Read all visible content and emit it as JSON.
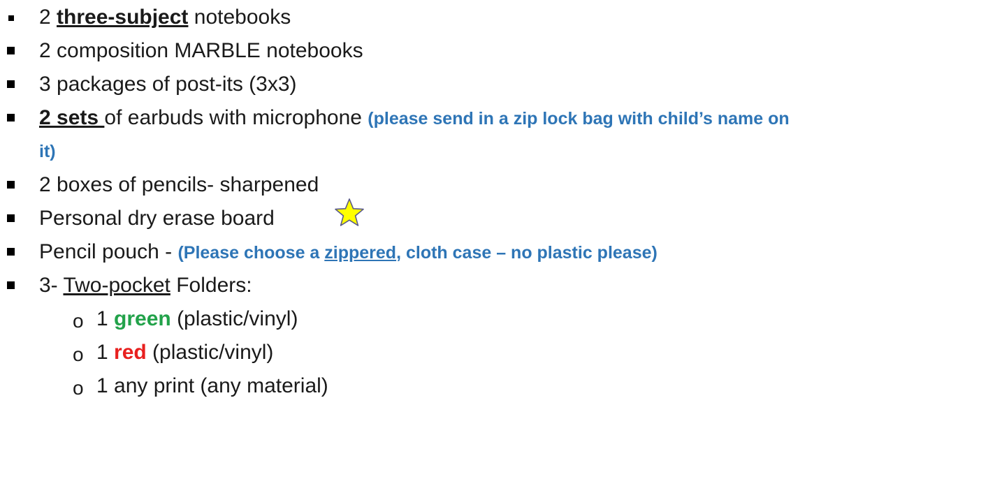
{
  "items": [
    {
      "prefix": "2 ",
      "emphasis": "three-subject",
      "suffix": " notebooks"
    },
    {
      "text": "2 composition MARBLE notebooks"
    },
    {
      "text": "3 packages of post-its (3x3)"
    },
    {
      "emphasis": "2 sets ",
      "middle": "of earbuds with microphone ",
      "note_line1": "(please send in a zip lock bag with child’s name on",
      "note_line2": "it)"
    },
    {
      "text": "2 boxes of pencils- sharpened"
    },
    {
      "text": "Personal dry erase board"
    },
    {
      "prefix": "Pencil pouch - ",
      "note_start": "(Please choose a ",
      "note_underlined": "zippered",
      "note_end": ", cloth case – no plastic please)"
    },
    {
      "prefix": "3- ",
      "underlined": "Two-pocket",
      "suffix": " Folders:"
    }
  ],
  "folders": [
    {
      "count": "1 ",
      "color_word": "green",
      "detail": " (plastic/vinyl)"
    },
    {
      "count": "1 ",
      "color_word": "red",
      "detail": " (plastic/vinyl)"
    },
    {
      "count": "1 any print (any material)"
    }
  ],
  "colors": {
    "note_blue": "#2e75b6",
    "green": "#22a24a",
    "red": "#e8201f",
    "star_fill": "#ffff00"
  },
  "icons": {
    "star": "star-icon",
    "bullet": "square-bullet",
    "sub_bullet": "circle-bullet"
  }
}
